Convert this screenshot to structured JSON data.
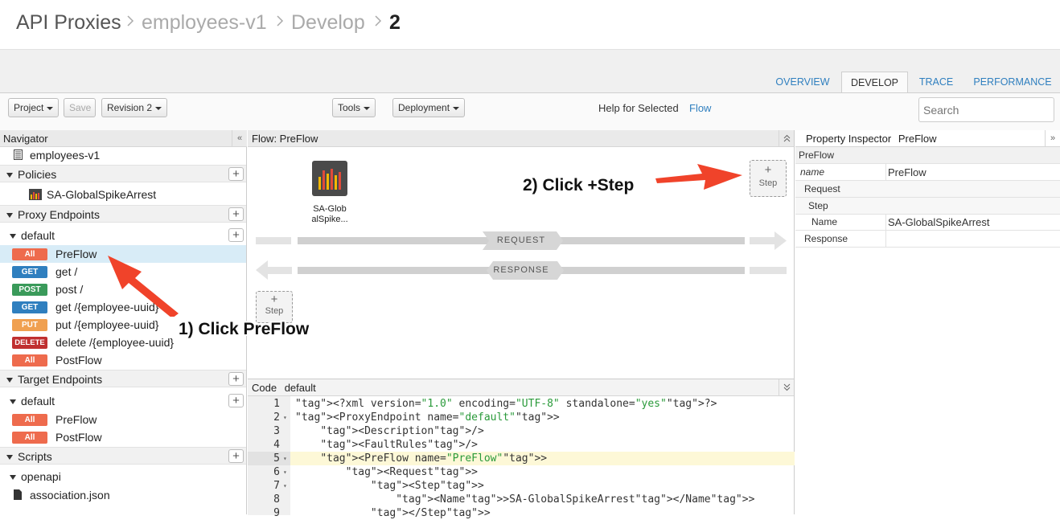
{
  "breadcrumb": [
    "API Proxies",
    "employees-v1",
    "Develop",
    "2"
  ],
  "tabs": [
    {
      "label": "OVERVIEW",
      "active": false
    },
    {
      "label": "DEVELOP",
      "active": true
    },
    {
      "label": "TRACE",
      "active": false
    },
    {
      "label": "PERFORMANCE",
      "active": false
    }
  ],
  "toolbar": {
    "project": "Project",
    "save": "Save",
    "revision": "Revision 2",
    "tools": "Tools",
    "deployment": "Deployment",
    "help_text": "Help for Selected",
    "help_link": "Flow",
    "search_placeholder": "Search"
  },
  "navigator": {
    "title": "Navigator",
    "collapse": "«",
    "proxy_name": "employees-v1",
    "policies_label": "Policies",
    "policy_item": "SA-GlobalSpikeArrest",
    "proxy_endpoints_label": "Proxy Endpoints",
    "proxy_default": "default",
    "proxy_flows": [
      {
        "badge": "All",
        "label": "PreFlow",
        "selected": true
      },
      {
        "badge": "GET",
        "label": "get /",
        "selected": false
      },
      {
        "badge": "POST",
        "label": "post /",
        "selected": false
      },
      {
        "badge": "GET",
        "label": "get /{employee-uuid}",
        "selected": false
      },
      {
        "badge": "PUT",
        "label": "put /{employee-uuid}",
        "selected": false
      },
      {
        "badge": "DELETE",
        "label": "delete /{employee-uuid}",
        "selected": false
      },
      {
        "badge": "All",
        "label": "PostFlow",
        "selected": false
      }
    ],
    "target_endpoints_label": "Target Endpoints",
    "target_default": "default",
    "target_flows": [
      {
        "badge": "All",
        "label": "PreFlow"
      },
      {
        "badge": "All",
        "label": "PostFlow"
      }
    ],
    "scripts_label": "Scripts",
    "scripts_folder": "openapi",
    "scripts_file": "association.json"
  },
  "flow": {
    "title": "Flow: PreFlow",
    "policy_label_1": "SA-Glob",
    "policy_label_2": "alSpike...",
    "request_label": "REQUEST",
    "response_label": "RESPONSE",
    "plus": "+",
    "step_label": "Step"
  },
  "code": {
    "title_prefix": "Code",
    "title_name": "default",
    "lines": [
      {
        "n": "1",
        "fold": "",
        "text": "<?xml version=\"1.0\" encoding=\"UTF-8\" standalone=\"yes\"?>"
      },
      {
        "n": "2",
        "fold": "▾",
        "text": "<ProxyEndpoint name=\"default\">"
      },
      {
        "n": "3",
        "fold": "",
        "text": "    <Description/>"
      },
      {
        "n": "4",
        "fold": "",
        "text": "    <FaultRules/>"
      },
      {
        "n": "5",
        "fold": "▾",
        "text": "    <PreFlow name=\"PreFlow\">"
      },
      {
        "n": "6",
        "fold": "▾",
        "text": "        <Request>"
      },
      {
        "n": "7",
        "fold": "▾",
        "text": "            <Step>"
      },
      {
        "n": "8",
        "fold": "",
        "text": "                <Name>SA-GlobalSpikeArrest</Name>"
      },
      {
        "n": "9",
        "fold": "",
        "text": "            </Step>"
      }
    ]
  },
  "inspector": {
    "title_prefix": "Property Inspector",
    "title_name": "PreFlow",
    "rows": [
      {
        "key": "PreFlow",
        "value": ""
      },
      {
        "key": "name",
        "value": "PreFlow"
      },
      {
        "key": "Request",
        "value": ""
      },
      {
        "key": "Step",
        "value": ""
      },
      {
        "key": "Name",
        "value": "SA-GlobalSpikeArrest"
      },
      {
        "key": "Response",
        "value": ""
      }
    ]
  },
  "annotations": {
    "click_preflow": "1) Click PreFlow",
    "click_step": "2) Click +Step"
  },
  "colors": {
    "link": "#2f7fbf",
    "badge_all": "#ee6b4d",
    "badge_get": "#2f7fbf",
    "badge_post": "#3a9a5a",
    "badge_put": "#f0a050",
    "badge_delete": "#c03030",
    "arrow": "#f0432a",
    "selected_row": "#d8ecf7"
  }
}
